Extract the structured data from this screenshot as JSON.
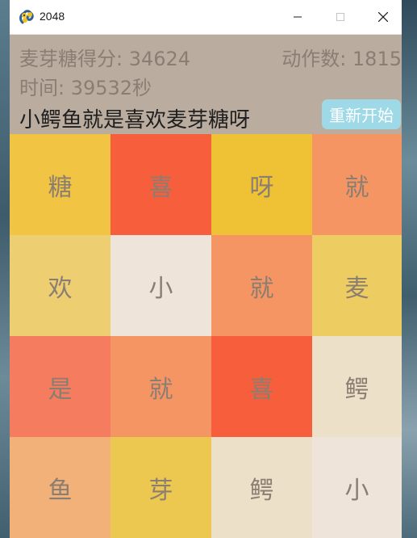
{
  "window": {
    "title": "2048",
    "icon": "pygame-snake-icon",
    "controls": [
      "minimize-icon",
      "maximize-icon",
      "close-icon"
    ]
  },
  "header": {
    "score_text": "麦芽糖得分: 34624",
    "moves_text": "动作数: 1815",
    "time_text": "时间: 39532秒",
    "slogan": "小鳄鱼就是喜欢麦芽糖呀",
    "restart_label": "重新开始"
  },
  "colors": {
    "header_bg": "#baac9f",
    "header_text": "#8a7e73",
    "restart_bg": "#9ed9e8"
  },
  "board": {
    "rows": [
      [
        {
          "char": "糖",
          "color": "#f2c443"
        },
        {
          "char": "喜",
          "color": "#f75e3c"
        },
        {
          "char": "呀",
          "color": "#eec234"
        },
        {
          "char": "就",
          "color": "#f59563"
        }
      ],
      [
        {
          "char": "欢",
          "color": "#edcf72"
        },
        {
          "char": "小",
          "color": "#eee4da"
        },
        {
          "char": "就",
          "color": "#f59563"
        },
        {
          "char": "麦",
          "color": "#edcc61"
        }
      ],
      [
        {
          "char": "是",
          "color": "#f67c5f"
        },
        {
          "char": "就",
          "color": "#f59563"
        },
        {
          "char": "喜",
          "color": "#f75e3c"
        },
        {
          "char": "鳄",
          "color": "#ede0c8"
        }
      ],
      [
        {
          "char": "鱼",
          "color": "#f2b179"
        },
        {
          "char": "芽",
          "color": "#edc850"
        },
        {
          "char": "鳄",
          "color": "#ede0c8"
        },
        {
          "char": "小",
          "color": "#eee4da"
        }
      ]
    ]
  }
}
